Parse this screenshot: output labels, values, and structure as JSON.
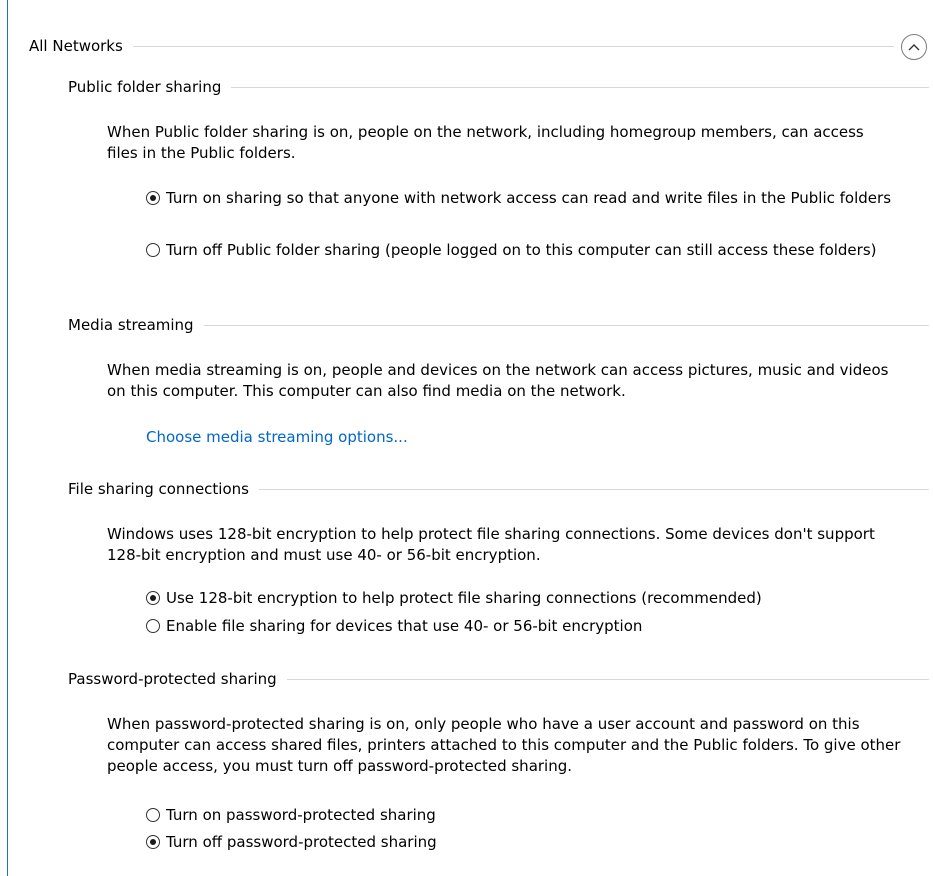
{
  "panel": {
    "title": "All Networks",
    "collapse_icon": "chevron-up-icon"
  },
  "public_folder_sharing": {
    "title": "Public folder sharing",
    "description": "When Public folder sharing is on, people on the network, including homegroup members, can access files in the Public folders.",
    "options": [
      {
        "label": "Turn on sharing so that anyone with network access can read and write files in the Public folders",
        "selected": true
      },
      {
        "label": "Turn off Public folder sharing (people logged on to this computer can still access these folders)",
        "selected": false
      }
    ]
  },
  "media_streaming": {
    "title": "Media streaming",
    "description": "When media streaming is on, people and devices on the network can access pictures, music and videos on this computer. This computer can also find media on the network.",
    "link_label": "Choose media streaming options...",
    "link_color": "#0066cc"
  },
  "file_sharing_connections": {
    "title": "File sharing connections",
    "description": "Windows uses 128-bit encryption to help protect file sharing connections. Some devices don't support 128-bit encryption and must use 40- or 56-bit encryption.",
    "options": [
      {
        "label": "Use 128-bit encryption to help protect file sharing connections (recommended)",
        "selected": true
      },
      {
        "label": "Enable file sharing for devices that use 40- or 56-bit encryption",
        "selected": false
      }
    ]
  },
  "password_protected_sharing": {
    "title": "Password-protected sharing",
    "description": "When password-protected sharing is on, only people who have a user account and password on this computer can access shared files, printers attached to this computer and the Public folders. To give other people access, you must turn off password-protected sharing.",
    "options": [
      {
        "label": "Turn on password-protected sharing",
        "selected": false
      },
      {
        "label": "Turn off password-protected sharing",
        "selected": true
      }
    ]
  }
}
